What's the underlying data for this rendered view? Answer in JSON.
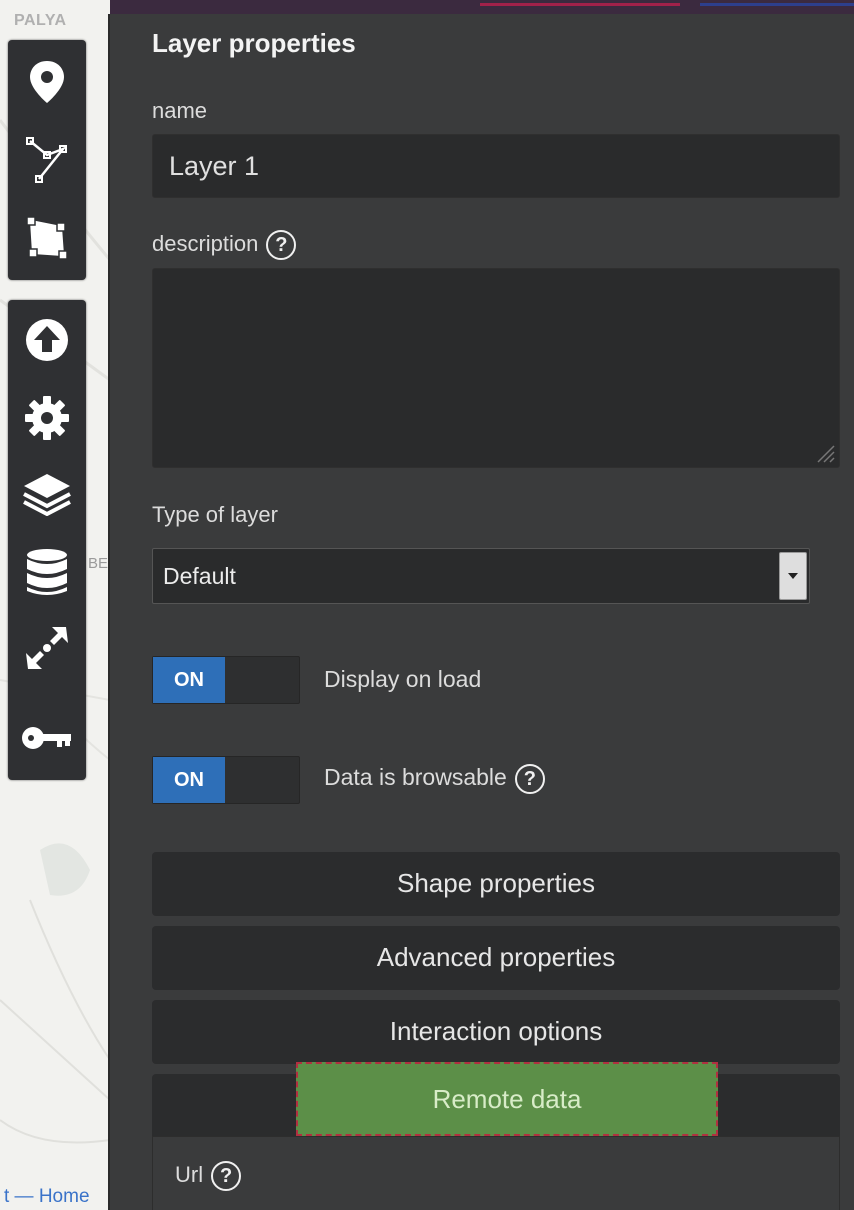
{
  "map": {
    "label_palya": "PALYA",
    "label_be": "BE",
    "attribution": "t — Home"
  },
  "toolbar": {
    "draw_tools": [
      {
        "icon": "marker-icon",
        "name": "draw-marker-button"
      },
      {
        "icon": "polyline-icon",
        "name": "draw-polyline-button"
      },
      {
        "icon": "polygon-icon",
        "name": "draw-polygon-button"
      }
    ],
    "tools": [
      {
        "icon": "upload-icon",
        "name": "import-data-button"
      },
      {
        "icon": "gear-icon",
        "name": "map-settings-button"
      },
      {
        "icon": "layers-icon",
        "name": "manage-layers-button"
      },
      {
        "icon": "database-icon",
        "name": "manage-datalayers-button"
      },
      {
        "icon": "center-icon",
        "name": "center-map-button"
      },
      {
        "icon": "key-icon",
        "name": "permissions-button"
      }
    ]
  },
  "panel": {
    "title": "Layer properties",
    "name_label": "name",
    "name_value": "Layer 1",
    "description_label": "description",
    "description_value": "",
    "help_glyph": "?",
    "type_label": "Type of layer",
    "type_value": "Default",
    "toggles": [
      {
        "state": "ON",
        "label": "Display on load"
      },
      {
        "state": "ON",
        "label": "Data is browsable"
      }
    ],
    "sections": [
      "Shape properties",
      "Advanced properties",
      "Interaction options"
    ],
    "remote_data_label": "Remote data",
    "url_label": "Url"
  },
  "colors": {
    "panel_bg": "#3a3b3c",
    "toggle_on": "#2e6fb8",
    "remote_btn": "#5c8f48",
    "link": "#3a73c9"
  }
}
